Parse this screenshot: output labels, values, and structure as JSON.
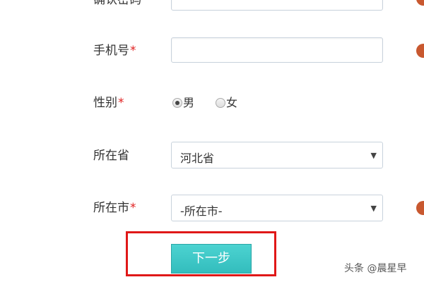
{
  "form": {
    "confirm_password": {
      "label": "确认密码",
      "value": ""
    },
    "phone": {
      "label": "手机号",
      "required_mark": "*",
      "value": ""
    },
    "gender": {
      "label": "性别",
      "required_mark": "*",
      "options": [
        {
          "label": "男",
          "checked": true
        },
        {
          "label": "女",
          "checked": false
        }
      ]
    },
    "province": {
      "label": "所在省",
      "selected": "河北省",
      "arrow": "▼"
    },
    "city": {
      "label": "所在市",
      "required_mark": "*",
      "selected": "-所在市-",
      "arrow": "▼"
    }
  },
  "actions": {
    "next_label": "下一步"
  },
  "highlight": {
    "color": "#e01818"
  },
  "watermark": "头条 @晨星早",
  "colors": {
    "button": "#3cc8c6",
    "required": "#e02020",
    "side_indicator": "#c8582f"
  }
}
